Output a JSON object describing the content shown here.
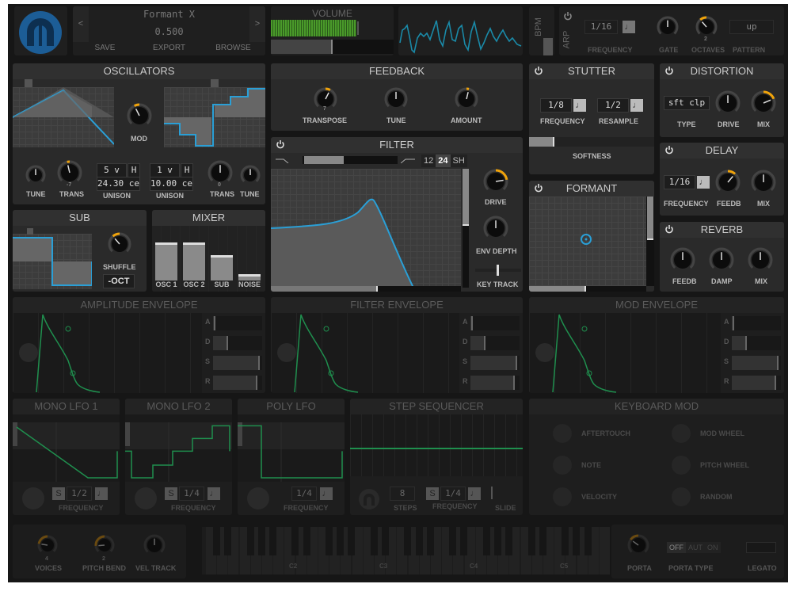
{
  "colors": {
    "accent": "#f0a30a",
    "wave": "#2a9fd6",
    "lfo": "#1f8f4e",
    "bg": "#161616"
  },
  "preset": {
    "name": "Formant X",
    "value": "0.500",
    "prev": "<",
    "next": ">",
    "save": "SAVE",
    "export": "EXPORT",
    "browse": "BROWSE"
  },
  "volume": {
    "title": "VOLUME",
    "level": 0.6,
    "slider": 0.5
  },
  "bpm": {
    "label": "BPM"
  },
  "arp": {
    "label": "ARP",
    "frequency": "1/16",
    "frequency_label": "FREQUENCY",
    "gate_label": "GATE",
    "octaves_label": "OCTAVES",
    "octaves_value": "2",
    "pattern": "up",
    "pattern_label": "PATTERN",
    "gate": 0.5,
    "octaves": 0.35
  },
  "oscillators": {
    "title": "OSCILLATORS",
    "mod_label": "MOD",
    "mod": 0.4,
    "osc1": {
      "tune_label": "TUNE",
      "trans_label": "TRANS",
      "trans_value": "-7",
      "unison_voices": "5 v",
      "unison_h": "H",
      "unison_detune": "24.30 ce",
      "unison_label": "UNISON",
      "tune": 0.5,
      "trans": 0.45
    },
    "osc2": {
      "tune_label": "TUNE",
      "trans_label": "TRANS",
      "trans_value": "0",
      "unison_voices": "1 v",
      "unison_h": "H",
      "unison_detune": "10.00 ce",
      "unison_label": "UNISON",
      "tune": 0.5,
      "trans": 0.5
    }
  },
  "sub": {
    "title": "SUB",
    "shuffle_label": "SHUFFLE",
    "shuffle": 0.35,
    "octave": "-OCT"
  },
  "mixer": {
    "title": "MIXER",
    "channels": [
      {
        "label": "OSC 1",
        "level": 0.6
      },
      {
        "label": "OSC 2",
        "level": 0.6
      },
      {
        "label": "SUB",
        "level": 0.4
      },
      {
        "label": "NOISE",
        "level": 0.1
      }
    ]
  },
  "feedback": {
    "title": "FEEDBACK",
    "transpose_label": "TRANSPOSE",
    "transpose_value": "7",
    "tune_label": "TUNE",
    "amount_label": "AMOUNT",
    "transpose": 0.6,
    "tune": 0.5,
    "amount": 0.55
  },
  "filter": {
    "title": "FILTER",
    "slopes": [
      "12",
      "24",
      "SH"
    ],
    "active_slope": "24",
    "drive_label": "DRIVE",
    "env_depth_label": "ENV DEPTH",
    "key_track_label": "KEY TRACK",
    "drive": 0.8,
    "env_depth": 0.5,
    "key_track": 0.5
  },
  "stutter": {
    "title": "STUTTER",
    "frequency": "1/8",
    "frequency_label": "FREQUENCY",
    "resample": "1/2",
    "resample_label": "RESAMPLE",
    "softness_label": "SOFTNESS",
    "softness": 0.2
  },
  "formant": {
    "title": "FORMANT"
  },
  "distortion": {
    "title": "DISTORTION",
    "type": "sft clp",
    "type_label": "TYPE",
    "drive_label": "DRIVE",
    "mix_label": "MIX",
    "drive": 0.5,
    "mix": 0.75
  },
  "delay": {
    "title": "DELAY",
    "frequency": "1/16",
    "frequency_label": "FREQUENCY",
    "feedb_label": "FEEDB",
    "mix_label": "MIX",
    "feedb": 0.65,
    "mix": 0.5
  },
  "reverb": {
    "title": "REVERB",
    "feedb_label": "FEEDB",
    "damp_label": "DAMP",
    "mix_label": "MIX",
    "feedb": 0.5,
    "damp": 0.5,
    "mix": 0.5
  },
  "envelopes": [
    {
      "title": "AMPLITUDE ENVELOPE"
    },
    {
      "title": "FILTER ENVELOPE"
    },
    {
      "title": "MOD ENVELOPE"
    }
  ],
  "adsr": [
    "A",
    "D",
    "S",
    "R"
  ],
  "lfos": [
    {
      "title": "MONO LFO 1",
      "sync": "S",
      "frequency": "1/2",
      "frequency_label": "FREQUENCY"
    },
    {
      "title": "MONO LFO 2",
      "sync": "S",
      "frequency": "1/4",
      "frequency_label": "FREQUENCY"
    },
    {
      "title": "POLY LFO",
      "frequency": "1/4",
      "frequency_label": "FREQUENCY"
    }
  ],
  "step_sequencer": {
    "title": "STEP SEQUENCER",
    "steps": "8",
    "steps_label": "STEPS",
    "sync": "S",
    "frequency": "1/4",
    "frequency_label": "FREQUENCY",
    "slide_label": "SLIDE"
  },
  "keyboard_mod": {
    "title": "KEYBOARD MOD",
    "sources": [
      "AFTERTOUCH",
      "MOD WHEEL",
      "NOTE",
      "PITCH WHEEL",
      "VELOCITY",
      "RANDOM"
    ]
  },
  "performance": {
    "voices_label": "VOICES",
    "voices_value": "4",
    "pitch_bend_label": "PITCH BEND",
    "pitch_bend_value": "2",
    "vel_track_label": "VEL TRACK",
    "voices": 0.2,
    "pitch_bend": 0.15,
    "vel_track": 0.5
  },
  "keyboard": {
    "octaves": [
      "C2",
      "C3",
      "C4",
      "C5"
    ]
  },
  "portamento": {
    "porta_label": "PORTA",
    "porta": 0.3,
    "types": [
      "OFF",
      "AUT",
      "ON"
    ],
    "active_type": "OFF",
    "porta_type_label": "PORTA TYPE",
    "legato_label": "LEGATO"
  }
}
